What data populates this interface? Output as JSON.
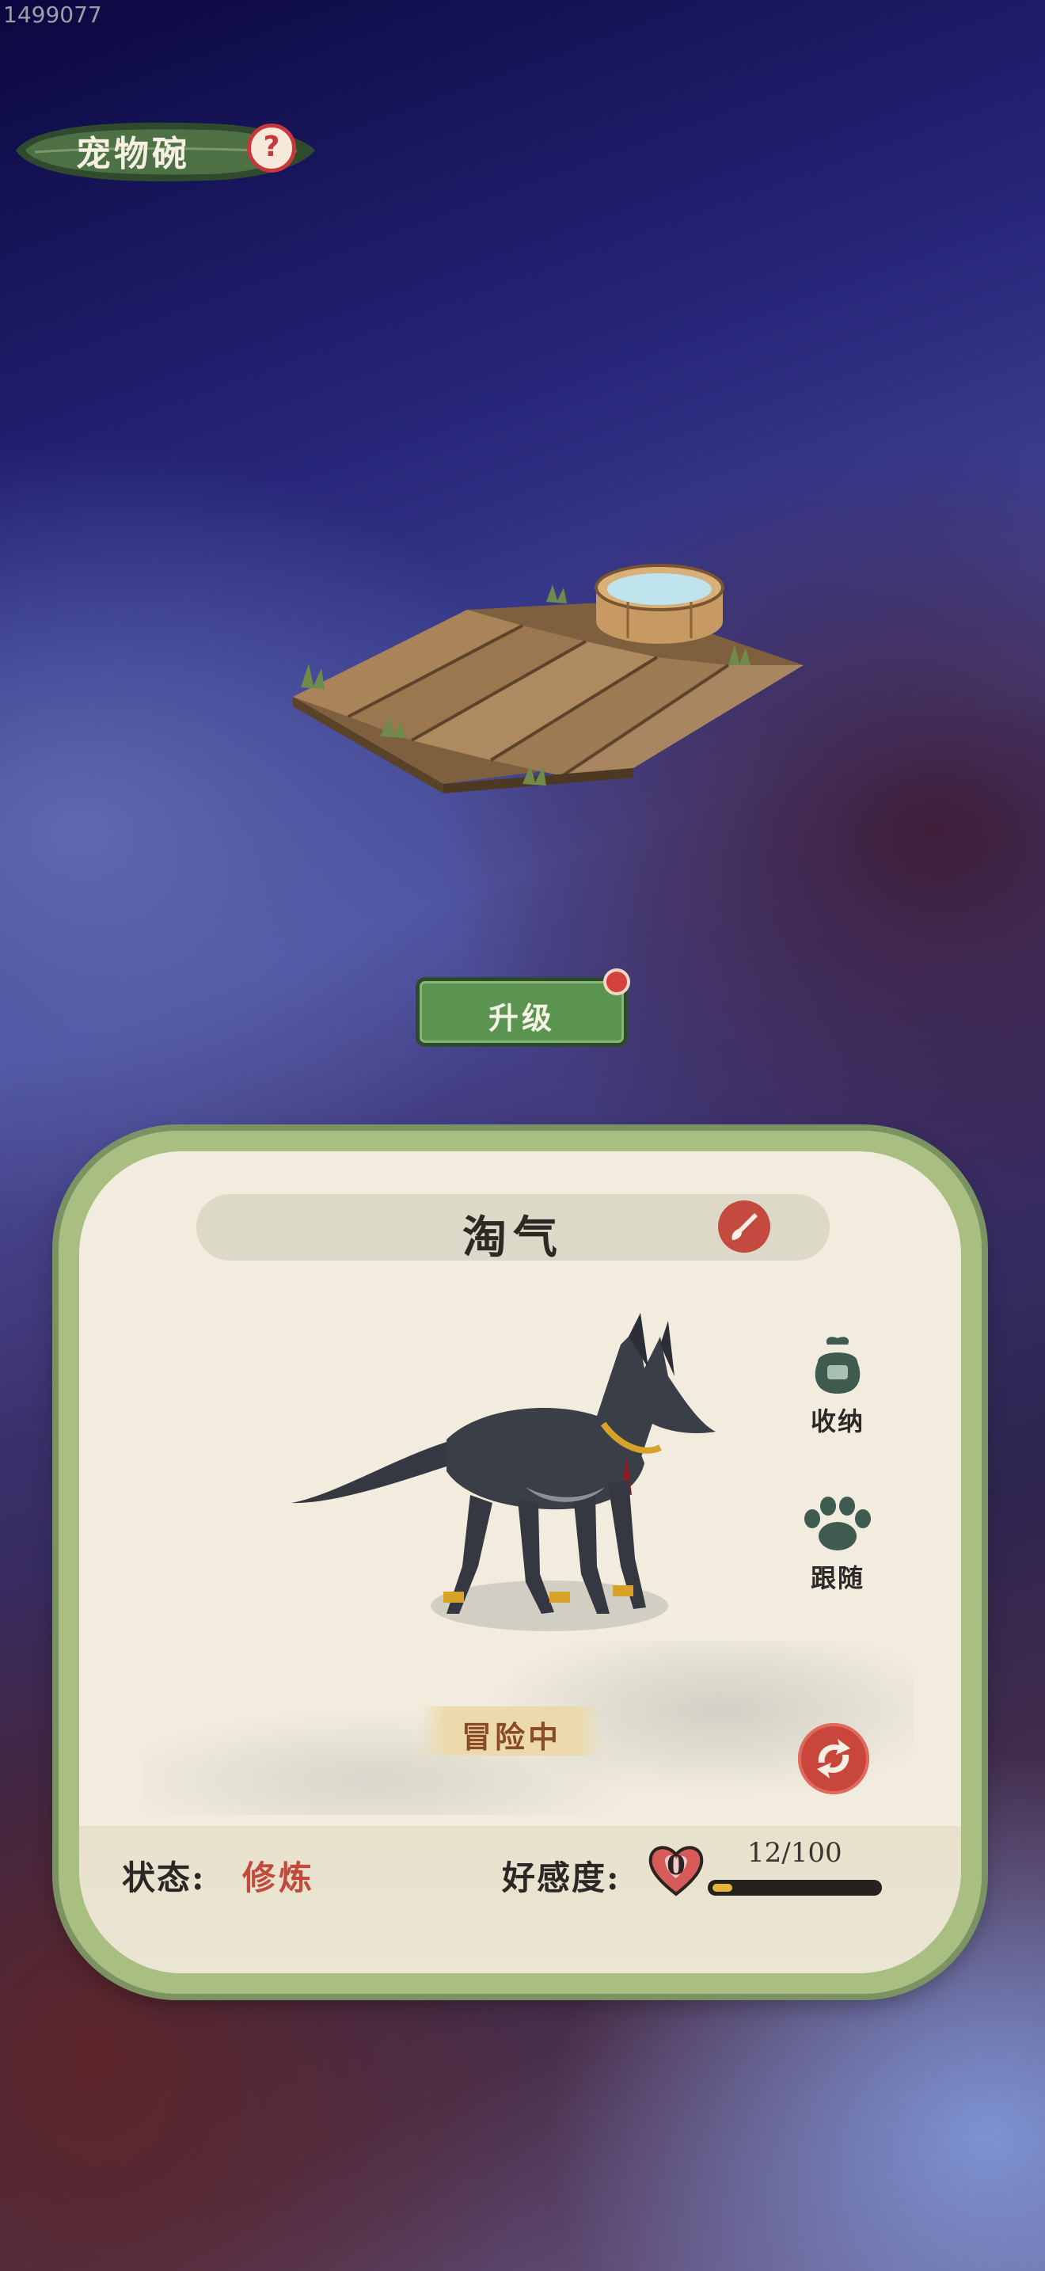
{
  "debug": {
    "id": "1499077"
  },
  "header": {
    "title": "宠物碗",
    "help_icon": "help-icon",
    "help_glyph": "?"
  },
  "upgrade": {
    "label": "升级",
    "has_notification": true
  },
  "pet_card": {
    "name": "淘气",
    "actions": [
      {
        "icon": "bag-icon",
        "label": "收纳"
      },
      {
        "icon": "paw-icon",
        "label": "跟随"
      }
    ],
    "adventure_tag": "冒险中",
    "status_key": "状态:",
    "status_value": "修炼",
    "favor_key": "好感度:",
    "favor_level": "0",
    "favor_current": 12,
    "favor_max": 100,
    "favor_text": "12/100"
  },
  "colors": {
    "accent_red": "#c4493f",
    "button_green": "#5a9450",
    "status_value": "#c24a3a",
    "favor_fill": "#e8b43a"
  }
}
